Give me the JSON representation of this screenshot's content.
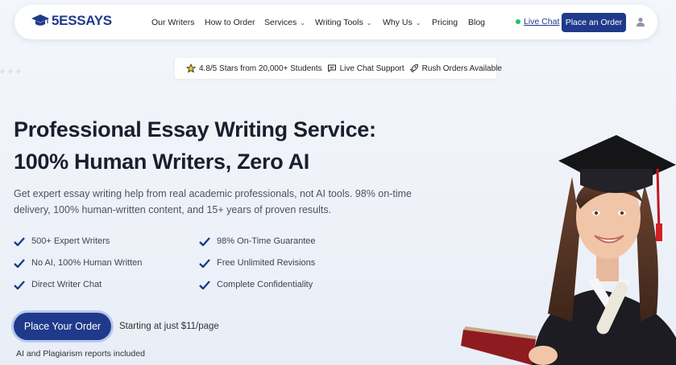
{
  "brand": {
    "logo_text": "5ESSAYS",
    "logo_icon": "graduation-cap-icon"
  },
  "nav": {
    "items": [
      {
        "label": "Our Writers",
        "dropdown": false
      },
      {
        "label": "How to Order",
        "dropdown": false
      },
      {
        "label": "Services",
        "dropdown": true
      },
      {
        "label": "Writing Tools",
        "dropdown": true
      },
      {
        "label": "Why Us",
        "dropdown": true
      },
      {
        "label": "Pricing",
        "dropdown": false
      },
      {
        "label": "Blog",
        "dropdown": false
      }
    ],
    "live_chat": "Live Chat",
    "order_button": "Place an Order",
    "account_icon": "user-icon"
  },
  "trust_bar": {
    "rating": "4.8/5 Stars from 20,000+ Students",
    "support": "Live Chat Support",
    "rush": "Rush Orders Available"
  },
  "hero": {
    "headline_line1": "Professional Essay Writing Service:",
    "headline_line2": "100% Human Writers, Zero AI",
    "subtext": "Get expert essay writing help from real academic professionals, not AI tools. 98% on-time delivery, 100% human-written content, and 15+ years of proven results.",
    "features_left": [
      "500+ Expert Writers",
      "No AI, 100% Human Written",
      "Direct Writer Chat"
    ],
    "features_right": [
      "98% On-Time Guarantee",
      "Free Unlimited Revisions",
      "Complete Confidentiality"
    ],
    "cta_label": "Place Your Order",
    "price_note": "Starting at just $11/page",
    "plagiarism_note": "AI and Plagiarism reports included"
  },
  "colors": {
    "brand_blue": "#1f3a8a",
    "check_blue": "#1f3a8a",
    "online_green": "#22c55e"
  }
}
